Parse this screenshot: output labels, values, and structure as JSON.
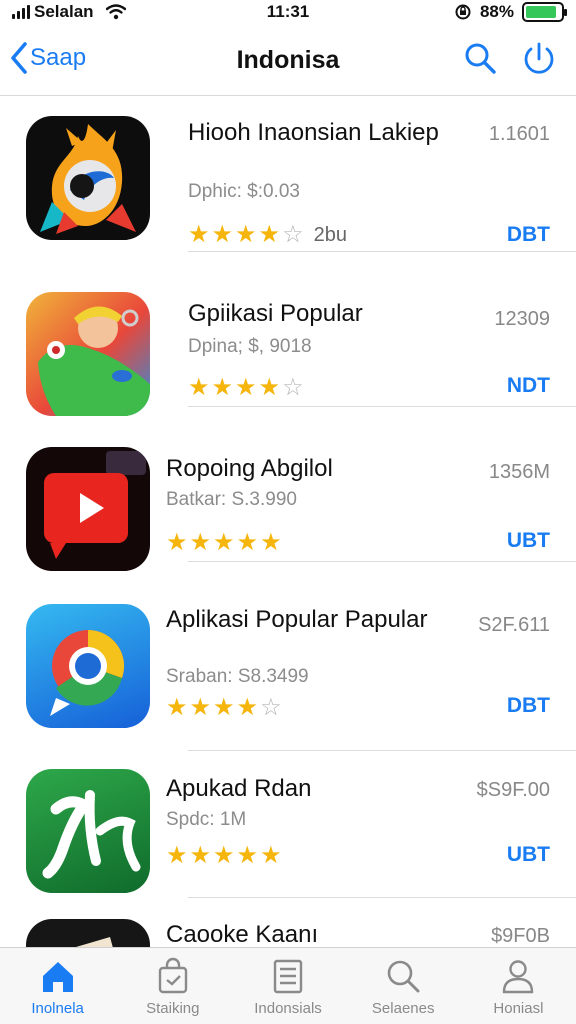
{
  "status_bar": {
    "carrier": "Selalan",
    "time": "11:31",
    "battery_percent": "88%",
    "battery_level": 0.88,
    "battery_color": "#35c759"
  },
  "nav": {
    "back_label": "Saap",
    "title": "Indonisa",
    "search_icon": "search-icon",
    "power_icon": "power-icon",
    "accent": "#1a7cf2"
  },
  "apps": [
    {
      "name": "Hiooh Inaonsian Lakiep",
      "subtitle": "Dphic: $:0.03",
      "rating": 3.5,
      "rating_count": "2bu",
      "price": "1.1601",
      "action": "DBT",
      "icon": "fire-mascot-icon"
    },
    {
      "name": "Gpiikasi Popular",
      "subtitle": "Dpina; $, 9018",
      "rating": 3.5,
      "rating_count": "",
      "price": "12309",
      "action": "NDT",
      "icon": "parrot-character-icon"
    },
    {
      "name": "Ropoing Abgilol",
      "subtitle": "Batkar: S.3.990",
      "rating": 4.5,
      "rating_count": "",
      "price": "1356M",
      "action": "UBT",
      "icon": "video-play-icon"
    },
    {
      "name": "Aplikasi Popular Papular",
      "subtitle": "Sraban: S8.3499",
      "rating": 4,
      "rating_count": "",
      "price": "S2F.611",
      "action": "DBT",
      "icon": "browser-icon"
    },
    {
      "name": "Apukad Rdan",
      "subtitle": "Spdc: 1M",
      "rating": 4.5,
      "rating_count": "",
      "price": "$S9F.00",
      "action": "UBT",
      "icon": "calligraphy-icon"
    },
    {
      "name": "Caooke Kaanı",
      "subtitle": "",
      "rating": 0,
      "rating_count": "",
      "price": "$9F0B",
      "action": "",
      "icon": "dark-app-icon"
    }
  ],
  "tabs": [
    {
      "label": "Inolnela",
      "icon": "home-icon",
      "active": true
    },
    {
      "label": "Staiking",
      "icon": "shopping-bag-icon",
      "active": false
    },
    {
      "label": "Indonsials",
      "icon": "list-document-icon",
      "active": false
    },
    {
      "label": "Selaenes",
      "icon": "search-icon",
      "active": false
    },
    {
      "label": "Honiasl",
      "icon": "profile-icon",
      "active": false
    }
  ]
}
